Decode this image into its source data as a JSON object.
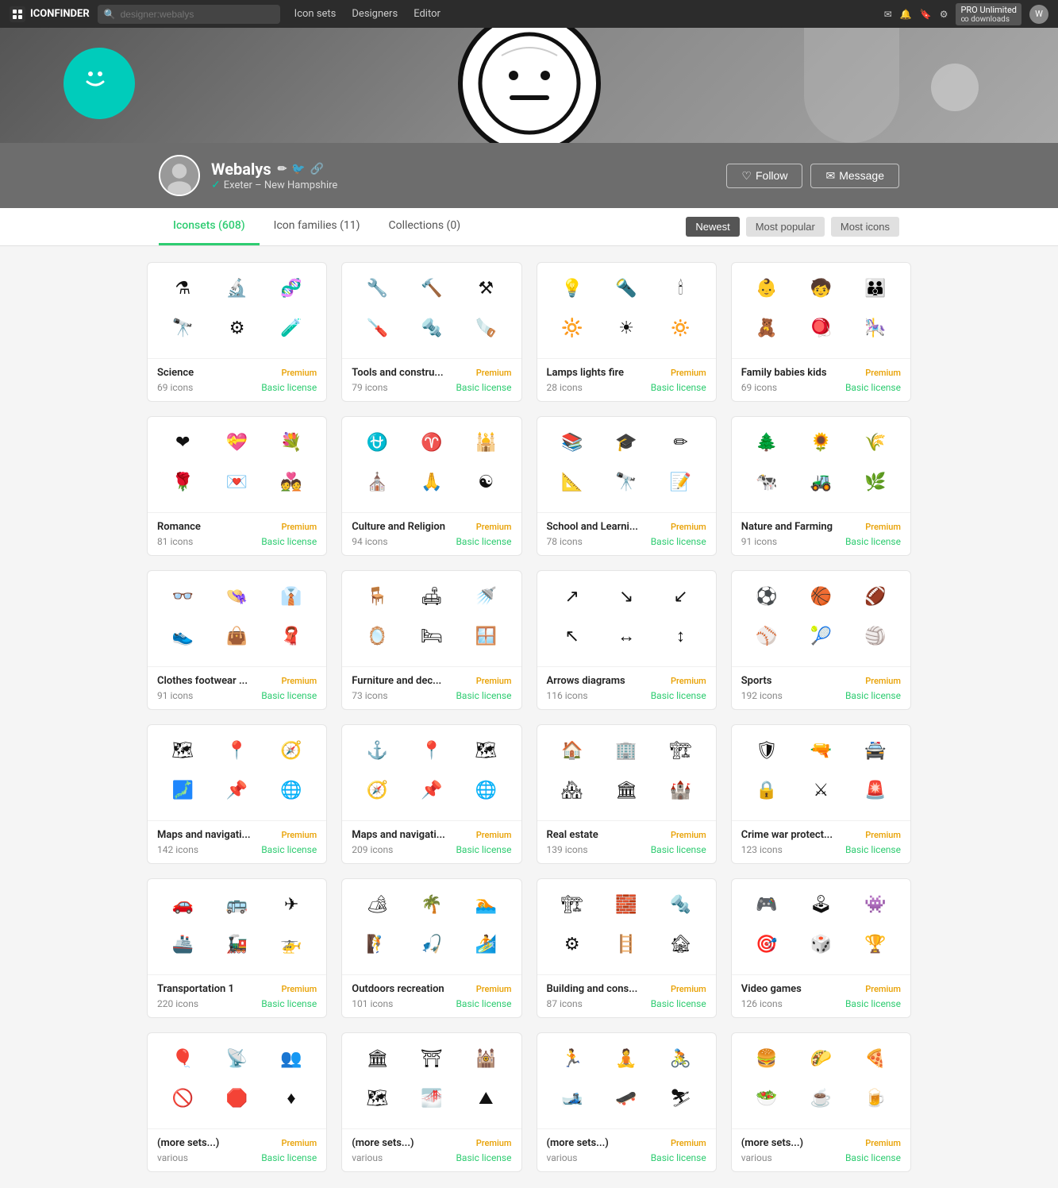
{
  "nav": {
    "logo": "ICONFINDER",
    "search_placeholder": "designer:webalys",
    "links": [
      {
        "label": "Icon sets",
        "has_dropdown": true
      },
      {
        "label": "Designers",
        "has_dropdown": true
      },
      {
        "label": "Editor",
        "has_dropdown": false
      }
    ],
    "pro_label": "PRO Unlimited",
    "pro_sub": "∞ downloads"
  },
  "profile": {
    "name": "Webalys",
    "location": "Exeter – New Hampshire",
    "verified": true,
    "follow_label": "Follow",
    "message_label": "Message"
  },
  "tabs": {
    "items": [
      {
        "label": "Iconsets (608)",
        "active": true
      },
      {
        "label": "Icon families (11)",
        "active": false
      },
      {
        "label": "Collections (0)",
        "active": false
      }
    ],
    "sort": [
      {
        "label": "Newest",
        "active": true
      },
      {
        "label": "Most popular",
        "active": false
      },
      {
        "label": "Most icons",
        "active": false
      }
    ]
  },
  "icon_sets": [
    {
      "title": "Science",
      "badge": "Premium",
      "count": "69 icons",
      "license": "Basic license",
      "icons": [
        "⚗",
        "🔬",
        "🧬",
        "🔭",
        "⚙",
        "🧪"
      ]
    },
    {
      "title": "Tools and constru...",
      "badge": "Premium",
      "count": "79 icons",
      "license": "Basic license",
      "icons": [
        "🔧",
        "🔨",
        "⚒",
        "🪛",
        "🔩",
        "🪚"
      ]
    },
    {
      "title": "Lamps lights fire",
      "badge": "Premium",
      "count": "28 icons",
      "license": "Basic license",
      "icons": [
        "💡",
        "🔦",
        "🕯",
        "🔆",
        "☀",
        "🔅"
      ]
    },
    {
      "title": "Family babies kids",
      "badge": "Premium",
      "count": "69 icons",
      "license": "Basic license",
      "icons": [
        "👶",
        "🧒",
        "👪",
        "🧸",
        "🪀",
        "🎠"
      ]
    },
    {
      "title": "Romance",
      "badge": "Premium",
      "count": "81 icons",
      "license": "Basic license",
      "icons": [
        "❤",
        "💝",
        "💐",
        "🌹",
        "💌",
        "💑"
      ]
    },
    {
      "title": "Culture and Religion",
      "badge": "Premium",
      "count": "94 icons",
      "license": "Basic license",
      "icons": [
        "⛎",
        "♈",
        "🕌",
        "⛪",
        "🙏",
        "☯"
      ]
    },
    {
      "title": "School and Learni...",
      "badge": "Premium",
      "count": "78 icons",
      "license": "Basic license",
      "icons": [
        "📚",
        "🎓",
        "✏",
        "📐",
        "🔭",
        "📝"
      ]
    },
    {
      "title": "Nature and Farming",
      "badge": "Premium",
      "count": "91 icons",
      "license": "Basic license",
      "icons": [
        "🌲",
        "🌻",
        "🌾",
        "🐄",
        "🚜",
        "🌿"
      ]
    },
    {
      "title": "Clothes footwear ...",
      "badge": "Premium",
      "count": "91 icons",
      "license": "Basic license",
      "icons": [
        "👓",
        "👒",
        "👔",
        "👟",
        "👜",
        "🧣"
      ]
    },
    {
      "title": "Furniture and dec...",
      "badge": "Premium",
      "count": "73 icons",
      "license": "Basic license",
      "icons": [
        "🪑",
        "🛋",
        "🚿",
        "🪞",
        "🛏",
        "🪟"
      ]
    },
    {
      "title": "Arrows diagrams",
      "badge": "Premium",
      "count": "116 icons",
      "license": "Basic license",
      "icons": [
        "↗",
        "↘",
        "↙",
        "↖",
        "↔",
        "↕"
      ]
    },
    {
      "title": "Sports",
      "badge": "Premium",
      "count": "192 icons",
      "license": "Basic license",
      "icons": [
        "⚽",
        "🏀",
        "🏈",
        "⚾",
        "🎾",
        "🏐"
      ]
    },
    {
      "title": "Maps and navigati...",
      "badge": "Premium",
      "count": "142 icons",
      "license": "Basic license",
      "icons": [
        "🗺",
        "📍",
        "🧭",
        "🗾",
        "📌",
        "🌐"
      ]
    },
    {
      "title": "Maps and navigati...",
      "badge": "Premium",
      "count": "209 icons",
      "license": "Basic license",
      "icons": [
        "⚓",
        "📍",
        "🗺",
        "🧭",
        "📌",
        "🌐"
      ]
    },
    {
      "title": "Real estate",
      "badge": "Premium",
      "count": "139 icons",
      "license": "Basic license",
      "icons": [
        "🏠",
        "🏢",
        "🏗",
        "🏘",
        "🏛",
        "🏰"
      ]
    },
    {
      "title": "Crime war protect...",
      "badge": "Premium",
      "count": "123 icons",
      "license": "Basic license",
      "icons": [
        "🛡",
        "🔫",
        "🚔",
        "🔒",
        "⚔",
        "🚨"
      ]
    },
    {
      "title": "Transportation 1",
      "badge": "Premium",
      "count": "220 icons",
      "license": "Basic license",
      "icons": [
        "🚗",
        "🚌",
        "✈",
        "🚢",
        "🚂",
        "🚁"
      ]
    },
    {
      "title": "Outdoors recreation",
      "badge": "Premium",
      "count": "101 icons",
      "license": "Basic license",
      "icons": [
        "🏕",
        "🌴",
        "🏊",
        "🧗",
        "🎣",
        "🏄"
      ]
    },
    {
      "title": "Building and cons...",
      "badge": "Premium",
      "count": "87 icons",
      "license": "Basic license",
      "icons": [
        "🏗",
        "🧱",
        "🔩",
        "⚙",
        "🪜",
        "🏚"
      ]
    },
    {
      "title": "Video games",
      "badge": "Premium",
      "count": "126 icons",
      "license": "Basic license",
      "icons": [
        "🎮",
        "🕹",
        "👾",
        "🎯",
        "🎲",
        "🏆"
      ]
    },
    {
      "title": "(more sets...)",
      "badge": "Premium",
      "count": "various",
      "license": "Basic license",
      "icons": [
        "🎈",
        "📡",
        "👥",
        "🚫",
        "🛑",
        "♦"
      ]
    },
    {
      "title": "(more sets...)",
      "badge": "Premium",
      "count": "various",
      "license": "Basic license",
      "icons": [
        "🏛",
        "⛩",
        "🕍",
        "🗺",
        "🌁",
        "⛰"
      ]
    },
    {
      "title": "(more sets...)",
      "badge": "Premium",
      "count": "various",
      "license": "Basic license",
      "icons": [
        "🏃",
        "🧘",
        "🚴",
        "🎿",
        "🛹",
        "⛷"
      ]
    },
    {
      "title": "(more sets...)",
      "badge": "Premium",
      "count": "various",
      "license": "Basic license",
      "icons": [
        "🍔",
        "🌮",
        "🍕",
        "🥗",
        "☕",
        "🍺"
      ]
    }
  ]
}
